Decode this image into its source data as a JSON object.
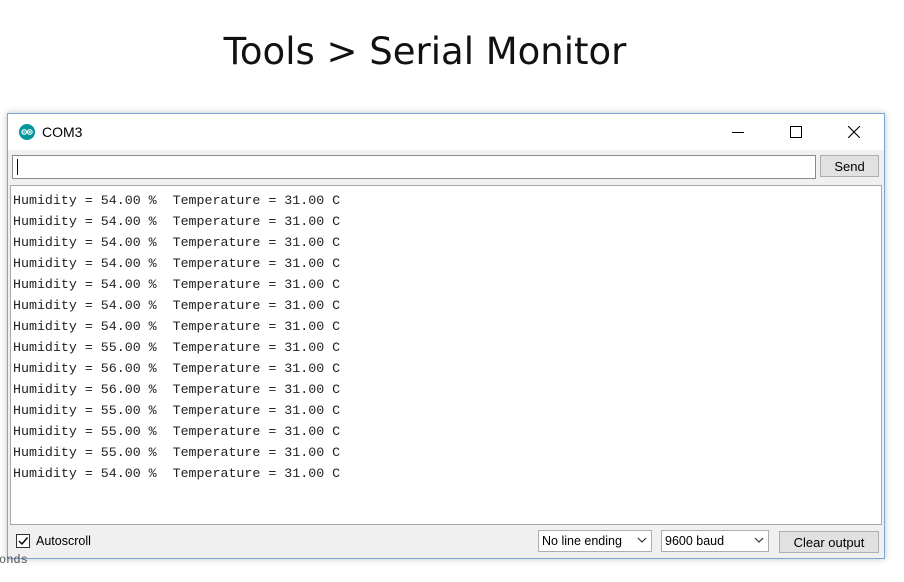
{
  "heading": "Tools > Serial Monitor",
  "window": {
    "title": "COM3",
    "icon": "arduino-icon",
    "controls": [
      "minimize-icon",
      "maximize-icon",
      "close-icon"
    ]
  },
  "input": {
    "value": "",
    "send_label": "Send"
  },
  "output_lines": [
    "Humidity = 54.00 %  Temperature = 31.00 C",
    "Humidity = 54.00 %  Temperature = 31.00 C",
    "Humidity = 54.00 %  Temperature = 31.00 C",
    "Humidity = 54.00 %  Temperature = 31.00 C",
    "Humidity = 54.00 %  Temperature = 31.00 C",
    "Humidity = 54.00 %  Temperature = 31.00 C",
    "Humidity = 54.00 %  Temperature = 31.00 C",
    "Humidity = 55.00 %  Temperature = 31.00 C",
    "Humidity = 56.00 %  Temperature = 31.00 C",
    "Humidity = 56.00 %  Temperature = 31.00 C",
    "Humidity = 55.00 %  Temperature = 31.00 C",
    "Humidity = 55.00 %  Temperature = 31.00 C",
    "Humidity = 55.00 %  Temperature = 31.00 C",
    "Humidity = 54.00 %  Temperature = 31.00 C"
  ],
  "bottom": {
    "autoscroll_label": "Autoscroll",
    "autoscroll_checked": true,
    "line_ending": "No line ending",
    "baud": "9600 baud",
    "clear_label": "Clear output"
  },
  "background_fragment": "onds",
  "colors": {
    "arduino_teal": "#00979c",
    "window_border": "#7aa7d6"
  }
}
